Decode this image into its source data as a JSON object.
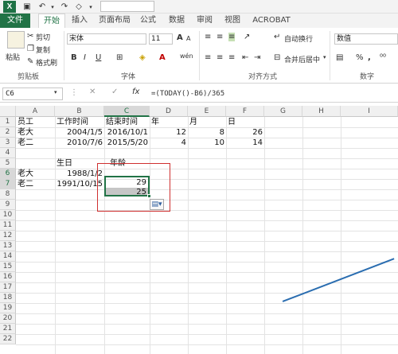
{
  "quick_access": {
    "undo": "↶",
    "redo": "↷"
  },
  "tabs": [
    "文件",
    "开始",
    "插入",
    "页面布局",
    "公式",
    "数据",
    "审阅",
    "视图",
    "ACROBAT"
  ],
  "ribbon": {
    "clipboard": {
      "paste": "粘贴",
      "cut": "剪切",
      "copy": "复制",
      "format_painter": "格式刷",
      "label": "剪贴板"
    },
    "font": {
      "name": "宋体",
      "size": "11",
      "label": "字体",
      "grow": "A",
      "shrink": "A",
      "bold": "B",
      "italic": "I",
      "underline": "U",
      "font_color": "A",
      "phonetic": "wén"
    },
    "alignment": {
      "wrap_text": "自动换行",
      "merge_center": "合并后居中",
      "label": "对齐方式"
    },
    "number": {
      "format": "数值",
      "percent": "%",
      "comma": ",",
      "label": "数字"
    }
  },
  "formula_bar": {
    "name_box": "C6",
    "fx": "fx",
    "formula": "=(TODAY()-B6)/365"
  },
  "columns": [
    "A",
    "B",
    "C",
    "D",
    "E",
    "F",
    "G",
    "H",
    "I"
  ],
  "rows": [
    "1",
    "2",
    "3",
    "4",
    "5",
    "6",
    "7",
    "8",
    "9",
    "10",
    "11",
    "12",
    "13",
    "14",
    "15",
    "16",
    "17",
    "18",
    "19",
    "20",
    "21",
    "22"
  ],
  "cells": {
    "a1": "员工",
    "b1": "工作时间",
    "c1": "结束时间",
    "d1": "年",
    "e1": "月",
    "f1": "日",
    "a2": "老大",
    "b2": "2004/1/5",
    "c2": "2016/10/1",
    "d2": "12",
    "e2": "8",
    "f2": "26",
    "a3": "老二",
    "b3": "2010/7/6",
    "c3": "2015/5/20",
    "d3": "4",
    "e3": "10",
    "f3": "14",
    "b5": "生日",
    "c5": "年龄",
    "a6": "老大",
    "b6": "1988/1/2",
    "c6": "29",
    "a7": "老二",
    "b7": "1991/10/15",
    "c7": "25"
  },
  "colors": {
    "excel_green": "#217346",
    "highlight_red": "#d03030",
    "selection_fill": "#c6c6c6"
  }
}
